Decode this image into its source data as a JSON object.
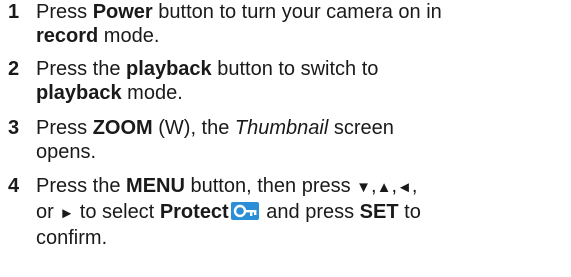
{
  "heading_fragment": "",
  "steps": [
    {
      "number": "1",
      "parts": {
        "p1": "Press ",
        "b1": "Power",
        "p2": " button to turn your camera on in",
        "b2": "record",
        "p3": " mode."
      }
    },
    {
      "number": "2",
      "parts": {
        "p1": "Press the ",
        "b1": "playback",
        "p2": " button to switch to",
        "b2": "playback",
        "p3": " mode."
      }
    },
    {
      "number": "3",
      "parts": {
        "p1": "Press ",
        "b1": "ZOOM",
        "p2": " (W), the ",
        "i1": "Thumbnail",
        "p3": " screen",
        "p4": "opens."
      }
    },
    {
      "number": "4",
      "parts": {
        "p1": "Press the ",
        "b1": "MENU",
        "p2": " button, then press ",
        "down": "▼",
        "c1": ",",
        "up": "▲",
        "c2": ",",
        "left": "◄",
        "c3": ",",
        "p3": "or ",
        "right": "►",
        "p4": " to select ",
        "b2": "Protect",
        "p5": " and press ",
        "b3": "SET",
        "p6": " to",
        "p7": "confirm."
      }
    }
  ],
  "icons": {
    "protect": "protect-icon"
  },
  "colors": {
    "text": "#1a1a1a",
    "protect_icon_bg": "#2a8fd6"
  }
}
